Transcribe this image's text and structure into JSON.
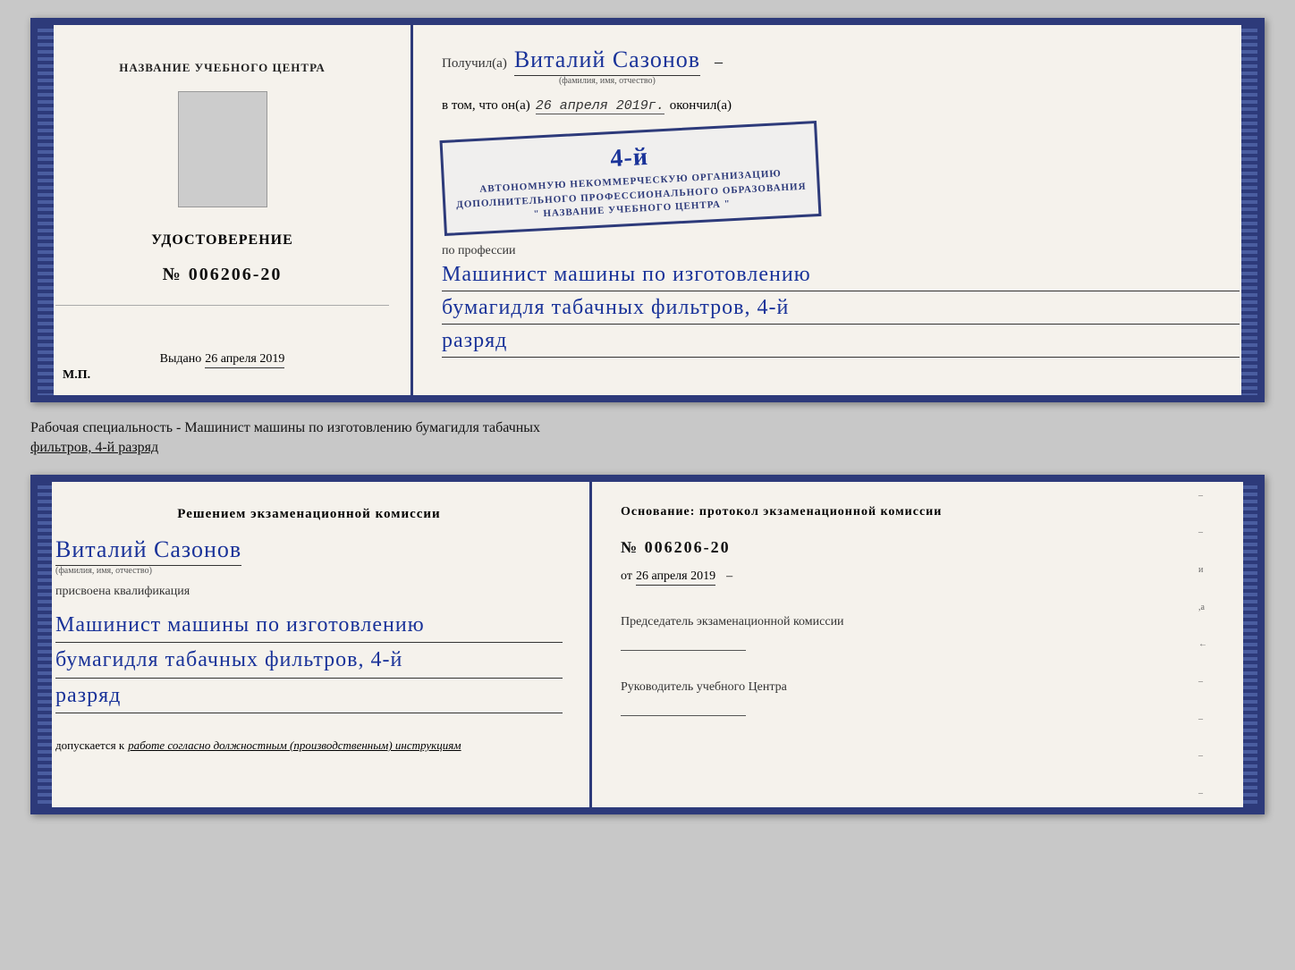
{
  "diploma": {
    "left": {
      "title": "НАЗВАНИЕ УЧЕБНОГО ЦЕНТРА",
      "cert_label": "УДОСТОВЕРЕНИЕ",
      "cert_number": "№ 006206-20",
      "issued_label": "Выдано",
      "issued_date": "26 апреля 2019",
      "mp_label": "М.П."
    },
    "right": {
      "recipient_label": "Получил(а)",
      "recipient_name": "Виталий Сазонов",
      "fio_sub": "(фамилия, имя, отчество)",
      "vtom_label": "в том, что он(а)",
      "date_value": "26 апреля 2019г.",
      "okonchil_label": "окончил(а)",
      "stamp_line1": "4-й",
      "stamp_line2": "АВТОНОМНУЮ НЕКОММЕРЧЕСКУЮ ОРГАНИЗАЦИЮ",
      "stamp_line3": "ДОПОЛНИТЕЛЬНОГО ПРОФЕССИОНАЛЬНОГО ОБРАЗОВАНИЯ",
      "stamp_line4": "\" НАЗВАНИЕ УЧЕБНОГО ЦЕНТРА \"",
      "profession_label": "по профессии",
      "profession_line1": "Машинист машины по изготовлению",
      "profession_line2": "бумагидля табачных фильтров, 4-й",
      "profession_line3": "разряд"
    }
  },
  "middle": {
    "text1": "Рабочая специальность - Машинист машины по изготовлению бумагидля табачных",
    "text2": "фильтров, 4-й разряд"
  },
  "bottom": {
    "left": {
      "commission_title": "Решением экзаменационной комиссии",
      "person_name": "Виталий Сазонов",
      "fio_sub": "(фамилия, имя, отчество)",
      "prisvoena_label": "присвоена квалификация",
      "qual_line1": "Машинист машины по изготовлению",
      "qual_line2": "бумагидля табачных фильтров, 4-й",
      "qual_line3": "разряд",
      "dopusk_label": "допускается к",
      "dopusk_value": "работе согласно должностным (производственным) инструкциям"
    },
    "right": {
      "osnov_label": "Основание: протокол экзаменационной комиссии",
      "protocol_number": "№ 006206-20",
      "ot_label": "от",
      "ot_date": "26 апреля 2019",
      "chairman_label": "Председатель экзаменационной комиссии",
      "head_label": "Руководитель учебного Центра"
    }
  }
}
